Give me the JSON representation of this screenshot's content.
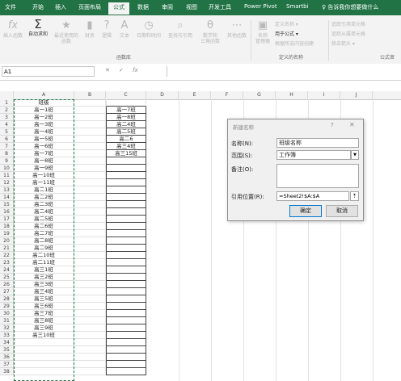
{
  "tabs": [
    "文件",
    "开始",
    "插入",
    "页面布局",
    "公式",
    "数据",
    "审阅",
    "视图",
    "开发工具",
    "Power Pivot",
    "Smartbi"
  ],
  "tell_me": "♀ 告诉我你想要做什么",
  "ribbon": {
    "insert_function": "插入函数",
    "autosum": "自动求和",
    "recent": "最近使用的\n函数",
    "financial": "财务",
    "logical": "逻辑",
    "text": "文本",
    "datetime": "日期和时间",
    "lookup": "查找与引用",
    "math": "数学和\n三角函数",
    "more": "其他函数",
    "function_library_label": "函数库",
    "name_manager": "名称\n管理器",
    "define_name": "定义名称 ▾",
    "use_in_formula": "用于公式 ▾",
    "create_from_selection": "根据所选内容创建",
    "defined_names_label": "定义的名称",
    "trace_precedents": "追踪引用单元格",
    "trace_dependents": "追踪从属单元格",
    "remove_arrows": "移去箭头 ▾",
    "formula_audit_label": "公式审"
  },
  "formula_bar": {
    "name_box": "A1",
    "fx": "fx",
    "cancel": "✕",
    "enter": "✓"
  },
  "columns": [
    "A",
    "B",
    "C",
    "D",
    "E",
    "F",
    "G",
    "H",
    "I",
    "J"
  ],
  "row_numbers": [
    1,
    2,
    3,
    4,
    5,
    6,
    7,
    8,
    9,
    10,
    11,
    12,
    13,
    14,
    15,
    16,
    17,
    18,
    19,
    20,
    21,
    22,
    23,
    24,
    25,
    26,
    27,
    28,
    29,
    30,
    31,
    32,
    33,
    34,
    35,
    36,
    37,
    38
  ],
  "col_a": [
    "班级",
    "高一1班",
    "高一2班",
    "高一3班",
    "高一4班",
    "高一5班",
    "高一6班",
    "高一7班",
    "高一8班",
    "高一9班",
    "高一10班",
    "高一11班",
    "高二1班",
    "高二2班",
    "高二3班",
    "高二4班",
    "高二5班",
    "高二6班",
    "高二7班",
    "高二8班",
    "高二9班",
    "高二10班",
    "高二11班",
    "高三1班",
    "高三2班",
    "高三3班",
    "高三4班",
    "高三5班",
    "高三6班",
    "高三7班",
    "高三8班",
    "高三9班",
    "高三10班"
  ],
  "col_c": [
    "",
    "高一7班",
    "高一8班",
    "高二4班",
    "高二5班",
    "高二6",
    "高三4班",
    "高三15班"
  ],
  "dialog": {
    "title": "新建名称",
    "help": "?",
    "close": "✕",
    "name_label": "名称(N):",
    "name_value": "班级名称",
    "scope_label": "范围(S):",
    "scope_value": "工作簿",
    "comment_label": "备注(O):",
    "refers_label": "引用位置(R):",
    "refers_value": "=Sheet2!$A:$A",
    "ok": "确定",
    "cancel": "取消"
  }
}
